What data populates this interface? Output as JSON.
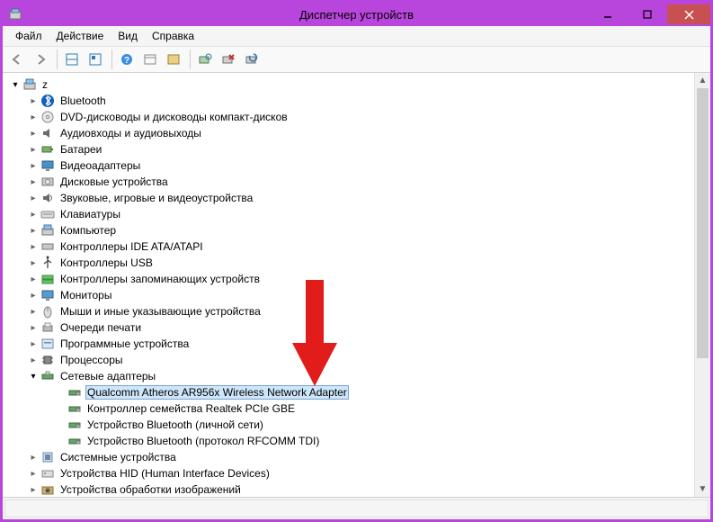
{
  "title": "Диспетчер устройств",
  "menu": {
    "file": "Файл",
    "action": "Действие",
    "view": "Вид",
    "help": "Справка"
  },
  "root": {
    "label": "z"
  },
  "nodes": [
    {
      "id": "bluetooth",
      "label": "Bluetooth"
    },
    {
      "id": "dvd",
      "label": "DVD-дисководы и дисководы компакт-дисков"
    },
    {
      "id": "audio-io",
      "label": "Аудиовходы и аудиовыходы"
    },
    {
      "id": "batteries",
      "label": "Батареи"
    },
    {
      "id": "display",
      "label": "Видеоадаптеры"
    },
    {
      "id": "disk",
      "label": "Дисковые устройства"
    },
    {
      "id": "svg-devices",
      "label": "Звуковые, игровые и видеоустройства"
    },
    {
      "id": "keyboards",
      "label": "Клавиатуры"
    },
    {
      "id": "computer",
      "label": "Компьютер"
    },
    {
      "id": "ide",
      "label": "Контроллеры IDE ATA/ATAPI"
    },
    {
      "id": "usb",
      "label": "Контроллеры USB"
    },
    {
      "id": "storage-ctrl",
      "label": "Контроллеры запоминающих устройств"
    },
    {
      "id": "monitors",
      "label": "Мониторы"
    },
    {
      "id": "mice",
      "label": "Мыши и иные указывающие устройства"
    },
    {
      "id": "print-queues",
      "label": "Очереди печати"
    },
    {
      "id": "software-dev",
      "label": "Программные устройства"
    },
    {
      "id": "cpus",
      "label": "Процессоры"
    },
    {
      "id": "net",
      "label": "Сетевые адаптеры",
      "expanded": true,
      "children": [
        {
          "id": "qualcomm-ar956x",
          "label": "Qualcomm Atheros AR956x Wireless Network Adapter",
          "selected": true
        },
        {
          "id": "realtek-pcie-gbe",
          "label": "Контроллер семейства Realtek PCIe GBE"
        },
        {
          "id": "bt-pan",
          "label": "Устройство Bluetooth (личной сети)"
        },
        {
          "id": "bt-rfcomm",
          "label": "Устройство Bluetooth (протокол RFCOMM TDI)"
        }
      ]
    },
    {
      "id": "system",
      "label": "Системные устройства"
    },
    {
      "id": "hid",
      "label": "Устройства HID (Human Interface Devices)"
    },
    {
      "id": "imaging",
      "label": "Устройства обработки изображений"
    }
  ]
}
